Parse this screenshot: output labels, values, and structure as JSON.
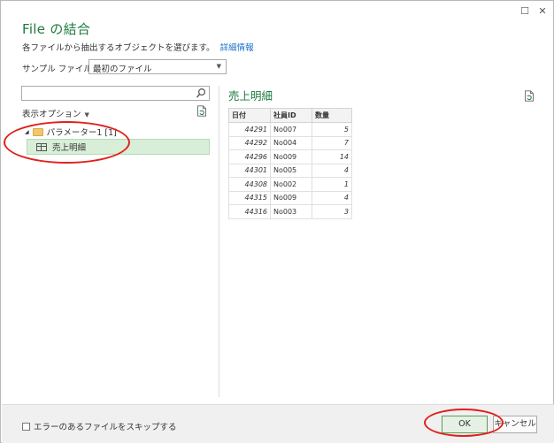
{
  "dialog": {
    "title": "File の結合",
    "description": "各ファイルから抽出するオブジェクトを選びます。",
    "details_link": "詳細情報",
    "close_glyph": "✕",
    "maximize_glyph": "☐"
  },
  "sample": {
    "label": "サンプル ファイル:",
    "value": "最初のファイル"
  },
  "navigator": {
    "display_options": "表示オプション",
    "folder_label": "パラメーター1 [1]",
    "item_label": "売上明細"
  },
  "preview": {
    "title": "売上明細",
    "columns": [
      "日付",
      "社員ID",
      "数量"
    ],
    "rows": [
      [
        "44291",
        "No007",
        "5"
      ],
      [
        "44292",
        "No004",
        "7"
      ],
      [
        "44296",
        "No009",
        "14"
      ],
      [
        "44301",
        "No005",
        "4"
      ],
      [
        "44308",
        "No002",
        "1"
      ],
      [
        "44315",
        "No009",
        "4"
      ],
      [
        "44316",
        "No003",
        "3"
      ]
    ]
  },
  "footer": {
    "skip_errors_label": "エラーのあるファイルをスキップする",
    "ok_label": "OK",
    "cancel_label": "キャンセル"
  },
  "colors": {
    "accent": "#1e7a3e",
    "annotation": "#e0201c",
    "link": "#1a6fc9"
  }
}
